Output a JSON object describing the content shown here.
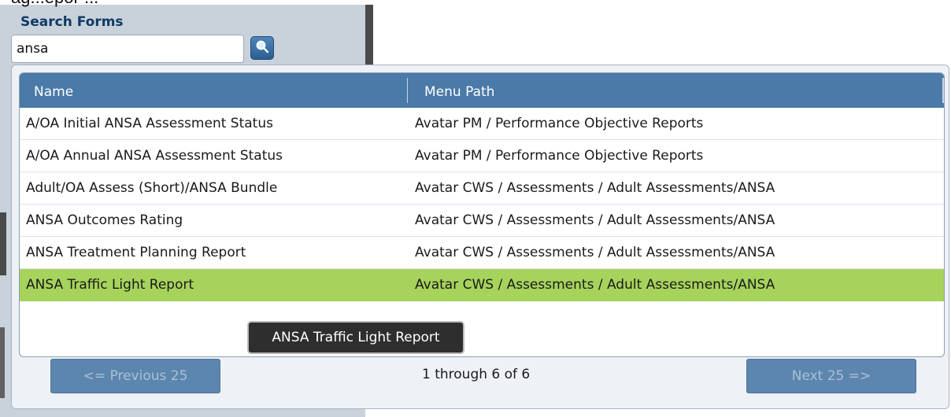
{
  "top_clipped_text": "ag...epor ...",
  "sidebar": {
    "title": "Search Forms",
    "search_value": "ansa"
  },
  "grid": {
    "columns": [
      "Name",
      "Menu Path"
    ],
    "rows": [
      {
        "name": "A/OA Initial ANSA Assessment Status",
        "path": "Avatar PM / Performance Objective Reports"
      },
      {
        "name": "A/OA Annual ANSA Assessment Status",
        "path": "Avatar PM / Performance Objective Reports"
      },
      {
        "name": "Adult/OA Assess (Short)/ANSA Bundle",
        "path": "Avatar CWS / Assessments / Adult Assessments/ANSA"
      },
      {
        "name": "ANSA Outcomes Rating",
        "path": "Avatar CWS / Assessments / Adult Assessments/ANSA"
      },
      {
        "name": "ANSA Treatment Planning Report",
        "path": "Avatar CWS / Assessments / Adult Assessments/ANSA"
      },
      {
        "name": "ANSA Traffic Light Report",
        "path": "Avatar CWS / Assessments / Adult Assessments/ANSA",
        "selected": true
      }
    ],
    "tooltip": "ANSA Traffic Light Report"
  },
  "pager": {
    "prev_label": "<= Previous 25",
    "status": "1 through 6 of 6",
    "next_label": "Next 25 =>"
  },
  "colors": {
    "header_bg": "#4a7aa8",
    "selected_row": "#a6d35c",
    "sidebar_bg": "#c9d2da"
  }
}
